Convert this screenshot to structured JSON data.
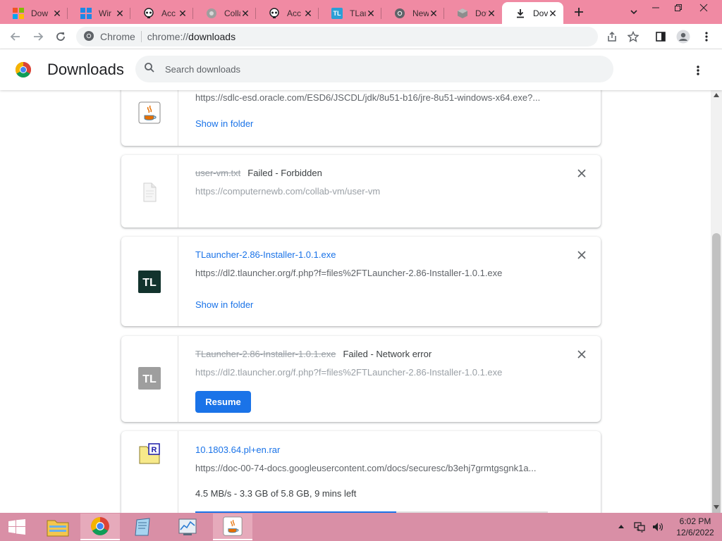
{
  "tabs": [
    {
      "title": "Dow",
      "icon": "windows-color-icon"
    },
    {
      "title": "Wir",
      "icon": "windows-blue-icon"
    },
    {
      "title": "Acc",
      "icon": "skull-icon"
    },
    {
      "title": "Colla",
      "icon": "globe-icon"
    },
    {
      "title": "Acc",
      "icon": "skull-icon"
    },
    {
      "title": "TLau",
      "icon": "tl-icon"
    },
    {
      "title": "New",
      "icon": "chrome-gray-icon"
    },
    {
      "title": "Dow",
      "icon": "box-icon"
    },
    {
      "title": "Dov",
      "icon": "download-icon",
      "active": true
    }
  ],
  "omnibox": {
    "site_label": "Chrome",
    "url_prefix": "chrome://",
    "url_rest": "downloads"
  },
  "page": {
    "title": "Downloads",
    "search_placeholder": "Search downloads"
  },
  "downloads": [
    {
      "name": "",
      "url": "https://sdlc-esd.oracle.com/ESD6/JSCDL/jdk/8u51-b16/jre-8u51-windows-x64.exe?...",
      "show_in_folder": "Show in folder",
      "icon": "java-icon"
    },
    {
      "name": "user-vm.txt",
      "status": "Failed - Forbidden",
      "url": "https://computernewb.com/collab-vm/user-vm",
      "icon": "text-file-icon"
    },
    {
      "name": "TLauncher-2.86-Installer-1.0.1.exe",
      "url": "https://dl2.tlauncher.org/f.php?f=files%2FTLauncher-2.86-Installer-1.0.1.exe",
      "show_in_folder": "Show in folder",
      "icon": "tl-icon"
    },
    {
      "name": "TLauncher-2.86-Installer-1.0.1.exe",
      "status": "Failed - Network error",
      "url": "https://dl2.tlauncher.org/f.php?f=files%2FTLauncher-2.86-Installer-1.0.1.exe",
      "button": "Resume",
      "icon": "tl-gray-icon"
    },
    {
      "name": "10.1803.64.pl+en.rar",
      "url": "https://doc-00-74-docs.googleusercontent.com/docs/securesc/b3ehj7grmtgsgnk1a...",
      "progress_text": "4.5 MB/s - 3.3 GB of 5.8 GB, 9 mins left",
      "progress_fraction": 0.57,
      "icon": "rar-icon"
    }
  ],
  "colors": {
    "tab_strip": "#f08aa3",
    "accent": "#1a73e8",
    "taskbar": "#d98fa6"
  },
  "clock": {
    "time": "6:02 PM",
    "date": "12/6/2022"
  }
}
